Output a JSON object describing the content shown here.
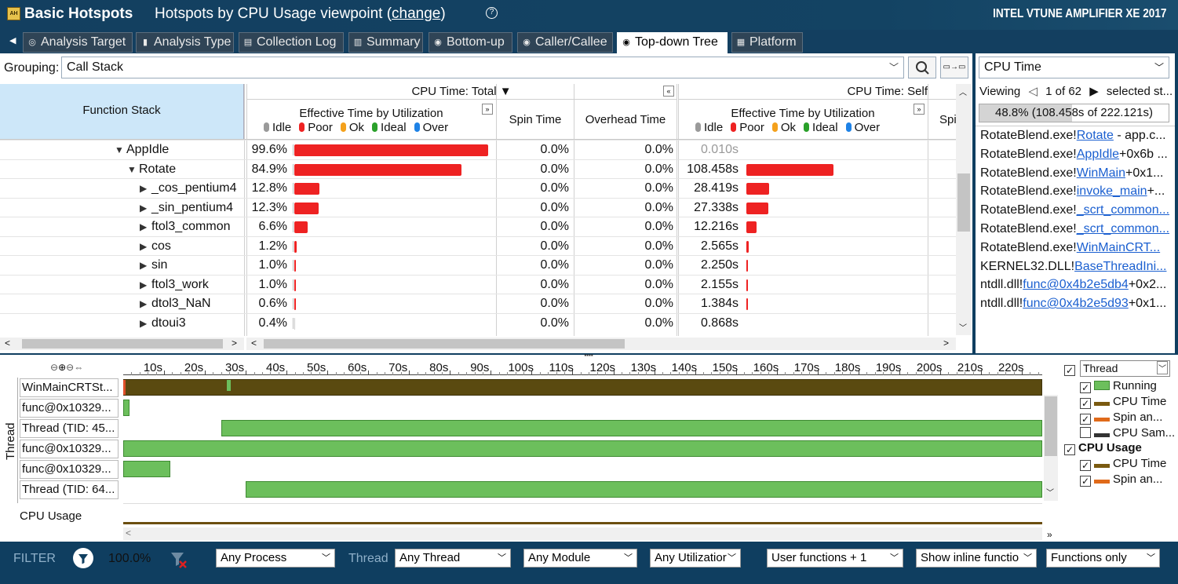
{
  "app": {
    "title": "Basic Hotspots",
    "viewpoint_prefix": "Hotspots by CPU Usage viewpoint (",
    "viewpoint_link": "change",
    "viewpoint_suffix": ")",
    "help": "?",
    "brand": "INTEL VTUNE AMPLIFIER XE 2017"
  },
  "tabs": [
    {
      "label": "Analysis Target",
      "icon": "target-icon"
    },
    {
      "label": "Analysis Type",
      "icon": "analysis-type-icon"
    },
    {
      "label": "Collection Log",
      "icon": "log-icon"
    },
    {
      "label": "Summary",
      "icon": "summary-icon"
    },
    {
      "label": "Bottom-up",
      "icon": "bottom-up-icon"
    },
    {
      "label": "Caller/Callee",
      "icon": "caller-callee-icon"
    },
    {
      "label": "Top-down Tree",
      "icon": "top-down-icon"
    },
    {
      "label": "Platform",
      "icon": "platform-icon"
    }
  ],
  "grouping": {
    "label": "Grouping:",
    "value": "Call Stack"
  },
  "grid": {
    "function_stack": "Function Stack",
    "cpu_total": "CPU Time: Total",
    "cpu_self": "CPU Time: Self",
    "effective": "Effective Time by Utilization",
    "spin": "Spin Time",
    "overhead": "Overhead Time",
    "spin_short": "Spi",
    "legend": [
      "Idle",
      "Poor",
      "Ok",
      "Ideal",
      "Over"
    ],
    "rows": [
      {
        "name": "AppIdle",
        "indent": 0,
        "expander": "▼",
        "total_pct": "99.6%",
        "total_frac": 0.996,
        "spin": "0.0%",
        "overhead": "0.0%",
        "self": "0.010s",
        "self_frac": 0.0,
        "self_dim": true
      },
      {
        "name": "Rotate",
        "indent": 1,
        "expander": "▼",
        "total_pct": "84.9%",
        "total_frac": 0.86,
        "spin": "0.0%",
        "overhead": "0.0%",
        "self": "108.458s",
        "self_frac": 1.0
      },
      {
        "name": "_cos_pentium4",
        "indent": 2,
        "expander": "▶",
        "total_pct": "12.8%",
        "total_frac": 0.13,
        "spin": "0.0%",
        "overhead": "0.0%",
        "self": "28.419s",
        "self_frac": 0.262
      },
      {
        "name": "_sin_pentium4",
        "indent": 2,
        "expander": "▶",
        "total_pct": "12.3%",
        "total_frac": 0.125,
        "spin": "0.0%",
        "overhead": "0.0%",
        "self": "27.338s",
        "self_frac": 0.252
      },
      {
        "name": "ftol3_common",
        "indent": 2,
        "expander": "▶",
        "total_pct": "6.6%",
        "total_frac": 0.067,
        "spin": "0.0%",
        "overhead": "0.0%",
        "self": "12.216s",
        "self_frac": 0.113
      },
      {
        "name": "cos",
        "indent": 2,
        "expander": "▶",
        "total_pct": "1.2%",
        "total_frac": 0.012,
        "spin": "0.0%",
        "overhead": "0.0%",
        "self": "2.565s",
        "self_frac": 0.024
      },
      {
        "name": "sin",
        "indent": 2,
        "expander": "▶",
        "total_pct": "1.0%",
        "total_frac": 0.01,
        "spin": "0.0%",
        "overhead": "0.0%",
        "self": "2.250s",
        "self_frac": 0.021
      },
      {
        "name": "ftol3_work",
        "indent": 2,
        "expander": "▶",
        "total_pct": "1.0%",
        "total_frac": 0.01,
        "spin": "0.0%",
        "overhead": "0.0%",
        "self": "2.155s",
        "self_frac": 0.02
      },
      {
        "name": "dtol3_NaN",
        "indent": 2,
        "expander": "▶",
        "total_pct": "0.6%",
        "total_frac": 0.006,
        "spin": "0.0%",
        "overhead": "0.0%",
        "self": "1.384s",
        "self_frac": 0.013
      },
      {
        "name": "dtoui3",
        "indent": 2,
        "expander": "▶",
        "total_pct": "0.4%",
        "total_frac": 0.0,
        "spin": "0.0%",
        "overhead": "0.0%",
        "self": "0.868s",
        "self_frac": 0.0
      }
    ]
  },
  "stack_pane": {
    "metric": "CPU Time",
    "viewing_label": "Viewing",
    "viewing_pos": "1 of 62",
    "viewing_suffix": "selected st...",
    "progress_text": "48.8% (108.458s of 222.121s)",
    "progress_frac": 0.488,
    "items": [
      {
        "mod": "RotateBlend.exe!",
        "fn": "Rotate",
        "rest": " - app.c..."
      },
      {
        "mod": "RotateBlend.exe!",
        "fn": "AppIdle",
        "rest": "+0x6b ..."
      },
      {
        "mod": "RotateBlend.exe!",
        "fn": "WinMain",
        "rest": "+0x1..."
      },
      {
        "mod": "RotateBlend.exe!",
        "fn": "invoke_main",
        "rest": "+..."
      },
      {
        "mod": "RotateBlend.exe!",
        "fn": "_scrt_common...",
        "rest": ""
      },
      {
        "mod": "RotateBlend.exe!",
        "fn": "_scrt_common...",
        "rest": ""
      },
      {
        "mod": "RotateBlend.exe!",
        "fn": "WinMainCRT...",
        "rest": ""
      },
      {
        "mod": "KERNEL32.DLL!",
        "fn": "BaseThreadIni...",
        "rest": ""
      },
      {
        "mod": "ntdll.dll!",
        "fn": "func@0x4b2e5db4",
        "rest": "+0x2..."
      },
      {
        "mod": "ntdll.dll!",
        "fn": "func@0x4b2e5d93",
        "rest": "+0x1..."
      }
    ]
  },
  "timeline": {
    "ticks": [
      "10s",
      "20s",
      "30s",
      "40s",
      "50s",
      "60s",
      "70s",
      "80s",
      "90s",
      "100s",
      "110s",
      "120s",
      "130s",
      "140s",
      "150s",
      "160s",
      "170s",
      "180s",
      "190s",
      "200s",
      "210s",
      "220s"
    ],
    "max_s": 225,
    "axis_label": "Thread",
    "threads": [
      {
        "label": "WinMainCRTSt...",
        "start": 0,
        "end": 225,
        "color": "#5a4a10"
      },
      {
        "label": "func@0x10329...",
        "start": 0,
        "end": 1.5,
        "color": "#6cbf5c"
      },
      {
        "label": "Thread (TID: 45...",
        "start": 24,
        "end": 225,
        "color": "#6cbf5c"
      },
      {
        "label": "func@0x10329...",
        "start": 0,
        "end": 225,
        "color": "#6cbf5c"
      },
      {
        "label": "func@0x10329...",
        "start": 0,
        "end": 11.5,
        "color": "#6cbf5c"
      },
      {
        "label": "Thread (TID: 64...",
        "start": 30,
        "end": 225,
        "color": "#6cbf5c"
      }
    ],
    "cpu_usage_label": "CPU Usage",
    "legend": {
      "group": "Thread",
      "items": [
        {
          "label": "Running",
          "checked": true,
          "swatch": "#6cbf5c"
        },
        {
          "label": "CPU Time",
          "checked": true,
          "swatch": "#7a5a10"
        },
        {
          "label": "Spin an...",
          "checked": true,
          "swatch": "#e06a1a"
        },
        {
          "label": "CPU Sam...",
          "checked": false,
          "swatch": "#333333"
        }
      ],
      "group2": "CPU Usage",
      "items2": [
        {
          "label": "CPU Time",
          "checked": true,
          "swatch": "#7a5a10"
        },
        {
          "label": "Spin an...",
          "checked": true,
          "swatch": "#e06a1a"
        }
      ]
    }
  },
  "filter": {
    "label": "FILTER",
    "percent": "100.0%",
    "thread_label": "Thread",
    "process": "Any Process",
    "thread": "Any Thread",
    "module": "Any Module",
    "utilization": "Any Utilizatior",
    "user_functions": "User functions + 1",
    "inline": "Show inline functio",
    "functions_only": "Functions only"
  }
}
